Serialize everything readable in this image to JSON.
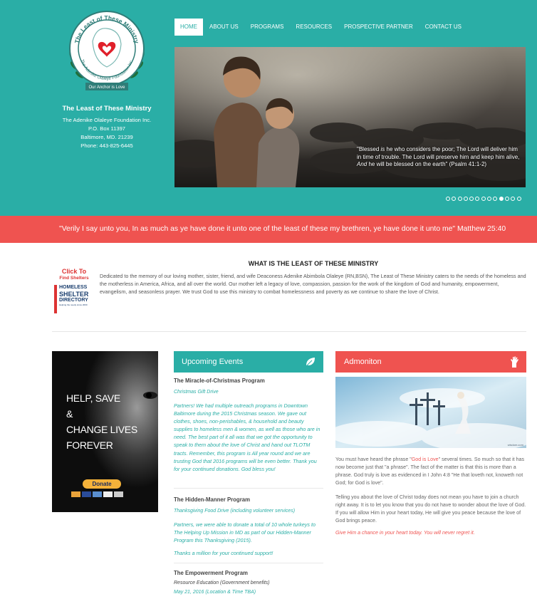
{
  "header": {
    "logo_text": {
      "ring_top": "The Least of These Ministry",
      "ring_bottom": "The Adenike Olaleye Foundation Inc.",
      "ribbon": "Our Anchor is Love"
    },
    "org_title": "The Least of These Ministry",
    "org_lines": [
      "The Adenike Olaleye Foundation Inc.",
      "P.O. Box 11397",
      "Baltimore, MD. 21239",
      "Phone: 443-825-6445"
    ]
  },
  "nav": {
    "items": [
      "HOME",
      "ABOUT US",
      "PROGRAMS",
      "RESOURCES",
      "PROSPECTIVE PARTNER",
      "CONTACT US"
    ],
    "active_index": 0
  },
  "slider": {
    "caption_parts": {
      "a": "\"Blessed ",
      "b": "is",
      "c": " he who considers the poor; The Lord will deliver him in time of trouble. The Lord will preserve him and keep him alive, ",
      "d": "And",
      "e": " he will be blessed on the earth\" (Psalm 41:1-2)"
    },
    "dot_count": 13,
    "active_dot_index": 9
  },
  "quote_banner": "\"Verily I say unto you, In as much as ye have done it unto one of the least of these my brethren, ye have done it unto me\" Matthew 25:40",
  "about": {
    "title": "WHAT IS THE LEAST OF THESE MINISTRY",
    "body": "Dedicated to the memory of our loving mother, sister, friend, and wife Deaconess Adenike Abimbola Olaleye (RN,BSN), The Least of These Ministry caters to the needs of the homeless and the motherless in America, Africa, and all over the world. Our mother left a legacy of love, compassion, passion for the work of the kingdom of God and humanity, empowerment, evangelism, and seasonless prayer. We trust God to use this ministry to combat homelessness and poverty as we continue to share the love of Christ."
  },
  "shelter_link": {
    "click": "Click To",
    "find": "Find Shelters",
    "logo_line1": "HOMELESS",
    "logo_line2": "SHELTER",
    "logo_line3": "DIRECTORY",
    "tagline": "Helping the needy since 2000"
  },
  "ad": {
    "lines": [
      "HELP, SAVE",
      "&",
      "CHANGE LIVES",
      "FOREVER"
    ],
    "donate_label": "Donate"
  },
  "events": {
    "heading": "Upcoming Events",
    "items": [
      {
        "title": "The Miracle-of-Christmas Program",
        "subtitle": "Christmas Gift Drive",
        "body": "Partners! We had multiple outreach programs in Downtown Baltimore during the 2015 Christmas season. We gave out clothes, shoes, non-perishables, & household and beauty supplies to homeless men & women, as well as those who are in need. The best part of it all was that we got the opportunity to speak to them about the love of Christ and hand out TLOTM tracts. Remember, this program is All year round and we are trusting God that 2016 programs will be even better. Thank you for your continued donations. God bless you!"
      },
      {
        "title": "The Hidden-Manner Program",
        "subtitle": "Thanksgiving Food Drive (including volunteer services)",
        "body": "Partners, we were able to donate a total of 10 whole turkeys to The Helping Up Mission in MD as part of our Hidden-Manner Program this Thanksgiving (2015).",
        "body2": "Thanks a million for your continued support!"
      },
      {
        "title": "The Empowerment Program",
        "subtitle": "Resource Education (Government benefits)",
        "date": "May 21, 2016 (Location & Time TBA)"
      }
    ]
  },
  "admonition": {
    "heading": "Admoniton",
    "watermark": "wisdom.com",
    "p1_a": "You must have heard the phrase \"",
    "p1_b": "God is Love",
    "p1_c": "\" several times. So much so that it has now become just that \"a phrase\". The fact of the matter is that this is more than a phrase. God truly is love as evidenced in I John 4:8 \"He that loveth not, knoweth not God; for God is love\".",
    "p2": "Telling you about the love of Christ today does not mean you have to join a church right away. It is to let you know that you do not have to wonder about the love of God. If you will allow Him in your heart today, He will give you peace because the love of God brings peace.",
    "cta": "Give Him a chance in your heart today. You will never regret it."
  },
  "colors": {
    "teal": "#2aaea6",
    "red": "#ef5350",
    "white": "#ffffff"
  }
}
